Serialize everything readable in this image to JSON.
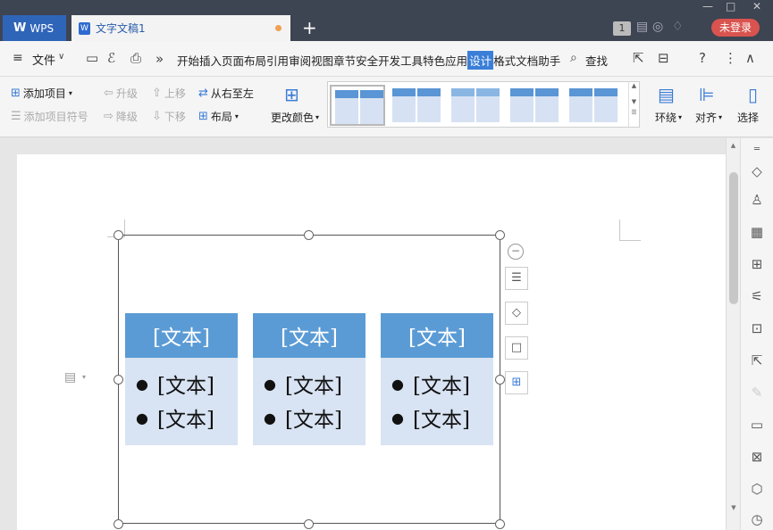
{
  "titlebar": {
    "app_tab": "WPS",
    "doc_tab": "文字文稿1",
    "new_tab": "+",
    "page_count": "1",
    "login_button": "未登录",
    "icons": [
      "new-tab-icon",
      "tshirt-icon",
      "minimize-icon",
      "maximize-icon",
      "close-icon"
    ]
  },
  "menubar": {
    "file_menu": "文件",
    "items": [
      "开始",
      "插入",
      "页面布局",
      "引用",
      "审阅",
      "视图",
      "章节",
      "安全",
      "开发工具",
      "特色应用",
      "设计",
      "格式",
      "文档助手"
    ],
    "active_item": "设计",
    "find": "查找",
    "more_chevron": "»",
    "help": "?",
    "more": "⋮"
  },
  "ribbon": {
    "add_item": "添加项目",
    "add_bullet": "添加项目符号",
    "promote": "升级",
    "demote": "降级",
    "move_up": "上移",
    "move_down": "下移",
    "right_to_left": "从右至左",
    "layout": "布局",
    "change_color": "更改颜色",
    "wrap": "环绕",
    "align": "对齐",
    "select": "选择"
  },
  "smartart": {
    "columns": [
      {
        "header": "[文本]",
        "bullets": [
          "[文本]",
          "[文本]"
        ]
      },
      {
        "header": "[文本]",
        "bullets": [
          "[文本]",
          "[文本]"
        ]
      },
      {
        "header": "[文本]",
        "bullets": [
          "[文本]",
          "[文本]"
        ]
      }
    ],
    "header_color": "#5b9bd5",
    "body_color": "#d8e3f3"
  },
  "colors": {
    "titlebar": "#3d4452",
    "accent": "#3b7ed8",
    "login": "#d9534f"
  }
}
